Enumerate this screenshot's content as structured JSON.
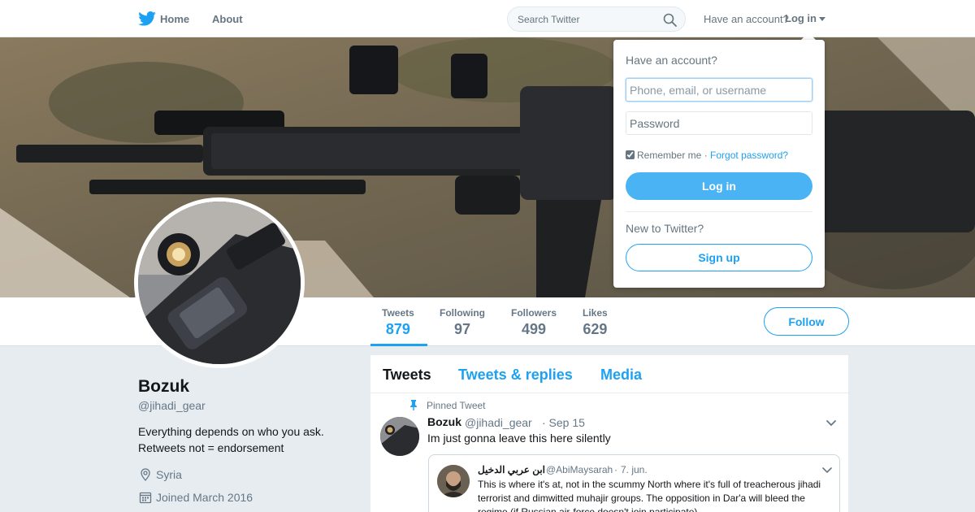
{
  "nav": {
    "home": "Home",
    "about": "About",
    "search_placeholder": "Search Twitter",
    "have_account": "Have an account?",
    "login": "Log in"
  },
  "stats": [
    {
      "label": "Tweets",
      "value": "879"
    },
    {
      "label": "Following",
      "value": "97"
    },
    {
      "label": "Followers",
      "value": "499"
    },
    {
      "label": "Likes",
      "value": "629"
    }
  ],
  "follow_label": "Follow",
  "profile": {
    "name": "Bozuk",
    "handle": "@jihadi_gear",
    "bio_line1": "Everything depends on who you ask.",
    "bio_line2": "Retweets not = endorsement",
    "location": "Syria",
    "joined": "Joined March 2016"
  },
  "timeline": {
    "tabs": [
      "Tweets",
      "Tweets & replies",
      "Media"
    ],
    "pinned_label": "Pinned Tweet",
    "tweet": {
      "name": "Bozuk",
      "handle": "@jihadi_gear",
      "date": "· Sep 15",
      "text": "Im just gonna leave this here silently"
    },
    "quote": {
      "name": "ابن عربي الدخيل",
      "handle": "@AbiMaysarah",
      "dot": "·",
      "date": "7. jun.",
      "text": "This is where it's at, not in the scummy North where it's full of treacherous jihadi terrorist and dimwitted muhajir groups. The opposition in Dar'a will bleed the regime (if Russian air-force doesn't join participate)"
    }
  },
  "login_dropdown": {
    "title": "Have an account?",
    "username_placeholder": "Phone, email, or username",
    "password_placeholder": "Password",
    "remember": "Remember me",
    "separator": "·",
    "forgot": "Forgot password?",
    "login_button": "Log in",
    "new_label": "New to Twitter?",
    "signup_button": "Sign up"
  },
  "colors": {
    "accent": "#1da1f2",
    "login_button": "#4ab3f4",
    "background": "#e6ecf0"
  },
  "icons": [
    "twitter-bird-icon",
    "search-icon",
    "pin-icon",
    "location-icon",
    "calendar-icon",
    "chevron-down-icon"
  ]
}
